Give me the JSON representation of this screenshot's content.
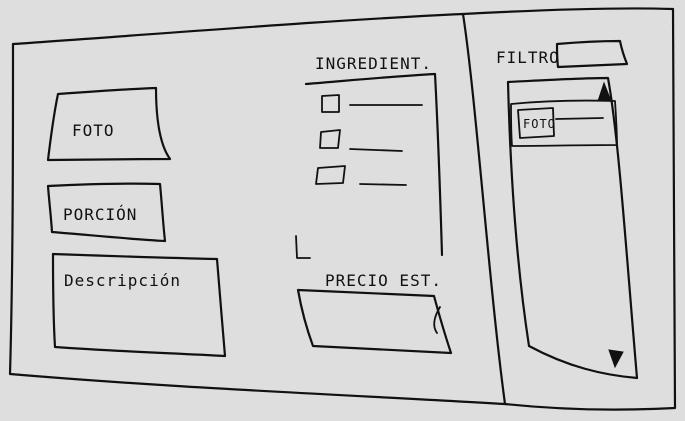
{
  "main": {
    "photo_label": "FOTO",
    "portion_label": "PORCIÓN",
    "description_label": "Descripción"
  },
  "ingredients": {
    "title": "INGREDIENT.",
    "items": [
      {
        "label": ""
      },
      {
        "label": ""
      },
      {
        "label": ""
      }
    ]
  },
  "price": {
    "title": "PRECIO EST."
  },
  "filter": {
    "label": "FILTRO",
    "input_value": "",
    "selected_item_label": "FOTO"
  }
}
